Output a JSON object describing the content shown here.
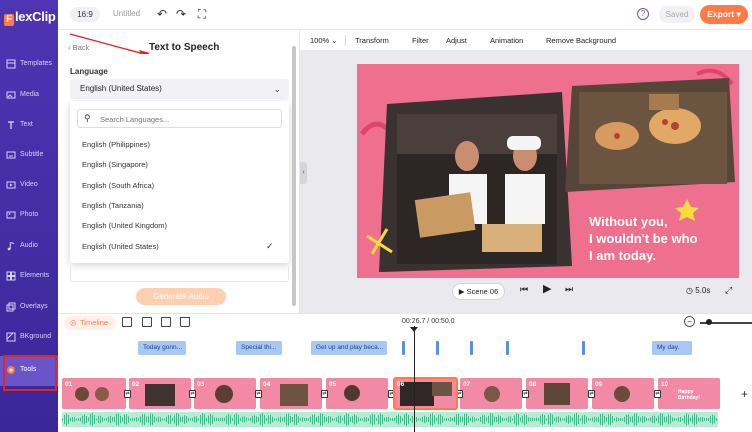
{
  "app": {
    "logo_text": "lexClip",
    "logo_badge": "F"
  },
  "sidebar": {
    "items": [
      {
        "label": "Templates",
        "icon": "templates-icon"
      },
      {
        "label": "Media",
        "icon": "media-icon"
      },
      {
        "label": "Text",
        "icon": "text-icon"
      },
      {
        "label": "Subtitle",
        "icon": "subtitle-icon"
      },
      {
        "label": "Video",
        "icon": "video-icon"
      },
      {
        "label": "Photo",
        "icon": "photo-icon"
      },
      {
        "label": "Audio",
        "icon": "audio-icon"
      },
      {
        "label": "Elements",
        "icon": "elements-icon"
      },
      {
        "label": "Overlays",
        "icon": "overlays-icon"
      },
      {
        "label": "BKground",
        "icon": "background-icon"
      },
      {
        "label": "Tools",
        "icon": "tools-icon",
        "active": true
      }
    ]
  },
  "topbar": {
    "ratio": "16:9",
    "title": "Untitled",
    "help": "?",
    "saved_label": "Saved",
    "export_label": "Export",
    "export_caret": "▾"
  },
  "panel": {
    "back_label": "Back",
    "title": "Text to Speech",
    "language_label": "Language",
    "selected_language": "English (United States)",
    "search_placeholder": "Search Languages...",
    "options": [
      "English (Philippines)",
      "English (Singapore)",
      "English (South Africa)",
      "English (Tanzania)",
      "English (United Kingdom)",
      "English (United States)"
    ],
    "checked_option": "English (United States)",
    "generate_label": "Generate Audio"
  },
  "editor_toolbar": {
    "zoom": "100%",
    "items": [
      "Transform",
      "Filter",
      "Adjust",
      "Animation",
      "Remove Background"
    ]
  },
  "canvas": {
    "caption_lines": [
      "Without you,",
      "I wouldn't be who",
      "I am today."
    ]
  },
  "player": {
    "scene_label": "Scene 06",
    "duration": "5.0s"
  },
  "timeline": {
    "tab_label": "Timeline",
    "time": "00:26.7 / 00:50.0",
    "text_clips": [
      "Today gonn...",
      "Special thi...",
      "Get up and play beca...",
      "My day."
    ],
    "scenes": [
      "01",
      "02",
      "03",
      "04",
      "05",
      "06",
      "07",
      "08",
      "09",
      "10"
    ],
    "selected_scene": "06",
    "last_scene_text": [
      "Happy",
      "Birthday!"
    ]
  },
  "colors": {
    "sidebar": "#4d35b3",
    "accent": "#ff7a45",
    "text_clip": "#a9c7f5",
    "audio": "#b8ead4",
    "video_bg": "#ee6f8e"
  }
}
